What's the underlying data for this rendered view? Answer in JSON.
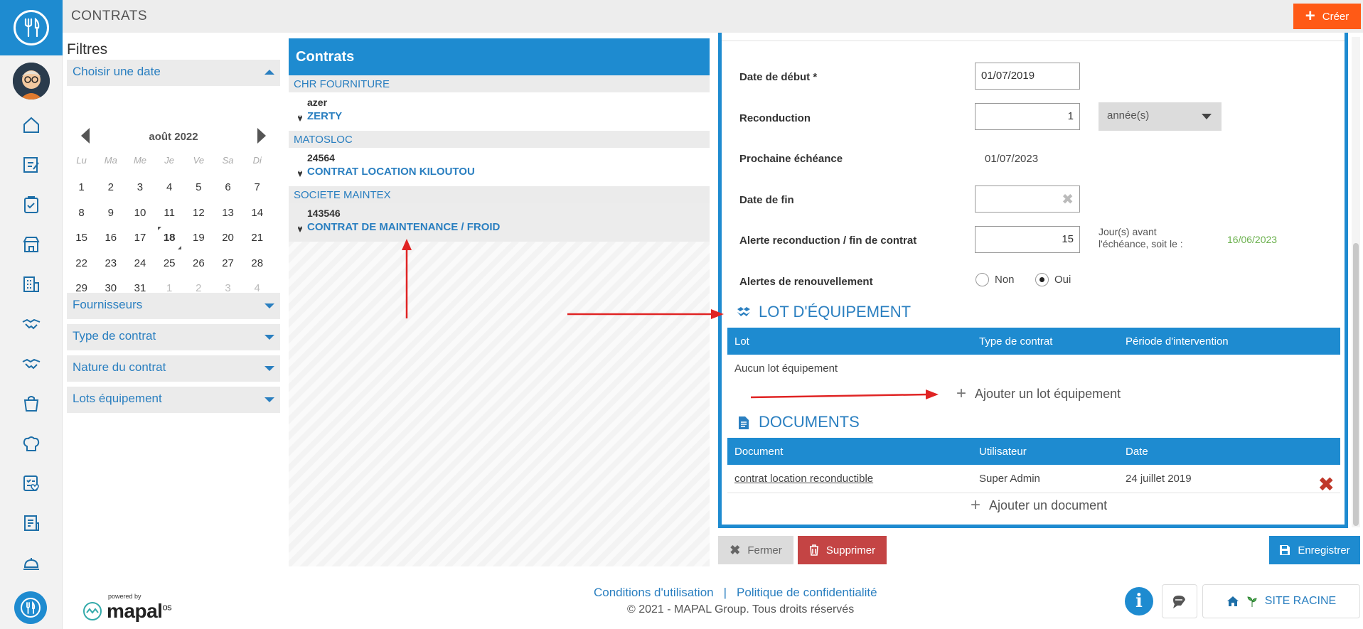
{
  "header": {
    "title": "CONTRATS",
    "create_label": "Créer"
  },
  "colors": {
    "brand_blue": "#1e8bd0",
    "create_orange": "#ff5a16",
    "delete_red": "#c44444",
    "date_green": "#6ab04c"
  },
  "sidebar": {
    "icons": [
      "home-icon",
      "edit-icon",
      "clipboard-check-icon",
      "store-icon",
      "building-icon",
      "handshake-icon",
      "handshake-alt-icon",
      "basket-icon",
      "chef-hat-icon",
      "checklist-heart-icon",
      "report-icon",
      "service-bell-icon"
    ]
  },
  "filters": {
    "title": "Filtres",
    "date_label": "Choisir une date",
    "calendar": {
      "month": "août 2022",
      "weekdays": [
        "Lu",
        "Ma",
        "Me",
        "Je",
        "Ve",
        "Sa",
        "Di"
      ],
      "weeks": [
        [
          "1",
          "2",
          "3",
          "4",
          "5",
          "6",
          "7"
        ],
        [
          "8",
          "9",
          "10",
          "11",
          "12",
          "13",
          "14"
        ],
        [
          "15",
          "16",
          "17",
          "18",
          "19",
          "20",
          "21"
        ],
        [
          "22",
          "23",
          "24",
          "25",
          "26",
          "27",
          "28"
        ],
        [
          "29",
          "30",
          "31",
          "1",
          "2",
          "3",
          "4"
        ]
      ],
      "today": "18"
    },
    "sections": [
      "Fournisseurs",
      "Type de contrat",
      "Nature du contrat",
      "Lots équipement"
    ]
  },
  "contracts": {
    "title": "Contrats",
    "groups": [
      {
        "supplier": "CHR FOURNITURE",
        "code": "azer",
        "name": "ZERTY"
      },
      {
        "supplier": "MATOSLOC",
        "code": "24564",
        "name": "CONTRAT LOCATION KILOUTOU"
      },
      {
        "supplier": "SOCIETE MAINTEX",
        "code": "143546",
        "name": "CONTRAT DE MAINTENANCE / FROID"
      }
    ]
  },
  "form": {
    "start_label": "Date de début *",
    "start_value": "01/07/2019",
    "renewal_label": "Reconduction",
    "renewal_value": "1",
    "renewal_unit": "année(s)",
    "next_label": "Prochaine échéance",
    "next_value": "01/07/2023",
    "end_label": "Date de fin",
    "end_value": "",
    "alert_label": "Alerte reconduction / fin de contrat",
    "alert_value": "15",
    "alert_hint_line1": "Jour(s) avant",
    "alert_hint_line2": "l'échéance, soit le :",
    "alert_date": "16/06/2023",
    "renew_alerts_label": "Alertes de renouvellement",
    "option_no": "Non",
    "option_yes": "Oui",
    "selected_option": "Oui"
  },
  "lots": {
    "title": "LOT D'ÉQUIPEMENT",
    "columns": [
      "Lot",
      "Type de contrat",
      "Période d'intervention"
    ],
    "empty_text": "Aucun lot équipement",
    "add_label": "Ajouter un lot équipement"
  },
  "documents": {
    "title": "DOCUMENTS",
    "columns": [
      "Document",
      "Utilisateur",
      "Date"
    ],
    "rows": [
      {
        "document": "contrat location reconductible",
        "user": "Super Admin",
        "date": "24 juillet 2019"
      }
    ],
    "add_label": "Ajouter un document"
  },
  "actions": {
    "close_label": "Fermer",
    "delete_label": "Supprimer",
    "save_label": "Enregistrer"
  },
  "footer": {
    "powered_by": "powered by",
    "brand": "mapal",
    "brand_suffix": "os",
    "terms": "Conditions d'utilisation",
    "separator": "|",
    "privacy": "Politique de confidentialité",
    "copyright": "© 2021 - MAPAL Group. Tous droits réservés",
    "site_label": "SITE RACINE"
  }
}
